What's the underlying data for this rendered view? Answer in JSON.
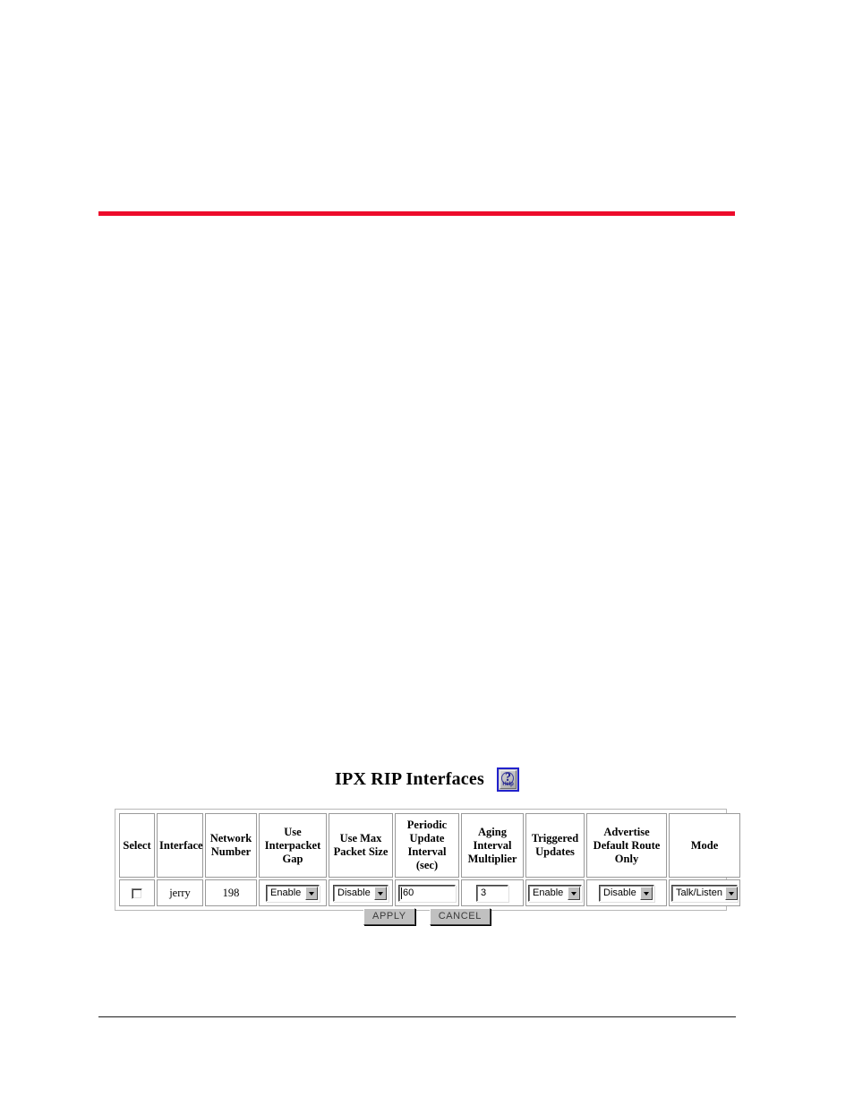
{
  "page": {
    "rule_color_top": "#ED0B2B",
    "rule_color_bottom": "#1C1C1C"
  },
  "figure": {
    "title": "IPX RIP Interfaces",
    "help_icon": {
      "name": "help-icon",
      "glyph": "?",
      "label": "Help",
      "border_color": "#2222CC",
      "text_color": "#1A1A8C"
    }
  },
  "table": {
    "headers": [
      "Select",
      "Interface",
      "Network Number",
      "Use Interpacket Gap",
      "Use Max Packet Size",
      "Periodic Update Interval (sec)",
      "Aging Interval Multiplier",
      "Triggered Updates",
      "Advertise Default Route Only",
      "Mode"
    ],
    "header_lines": {
      "select": "Select",
      "interface": "Interface",
      "network_number_1": "Network",
      "network_number_2": "Number",
      "interpacket_1": "Use",
      "interpacket_2": "Interpacket",
      "interpacket_3": "Gap",
      "maxpacket_1": "Use Max",
      "maxpacket_2": "Packet Size",
      "periodic_1": "Periodic",
      "periodic_2": "Update",
      "periodic_3": "Interval",
      "periodic_4": "(sec)",
      "aging_1": "Aging",
      "aging_2": "Interval",
      "aging_3": "Multiplier",
      "triggered_1": "Triggered",
      "triggered_2": "Updates",
      "advertise_1": "Advertise",
      "advertise_2": "Default Route",
      "advertise_3": "Only",
      "mode": "Mode"
    },
    "rows": [
      {
        "select_checked": false,
        "interface": "jerry",
        "network_number": "198",
        "use_interpacket_gap": "Enable",
        "use_max_packet_size": "Disable",
        "periodic_update_interval": "60",
        "aging_interval_multiplier": "3",
        "triggered_updates": "Enable",
        "advertise_default_route_only": "Disable",
        "mode": "Talk/Listen"
      }
    ]
  },
  "actions": {
    "apply_label": "APPLY",
    "cancel_label": "CANCEL"
  }
}
